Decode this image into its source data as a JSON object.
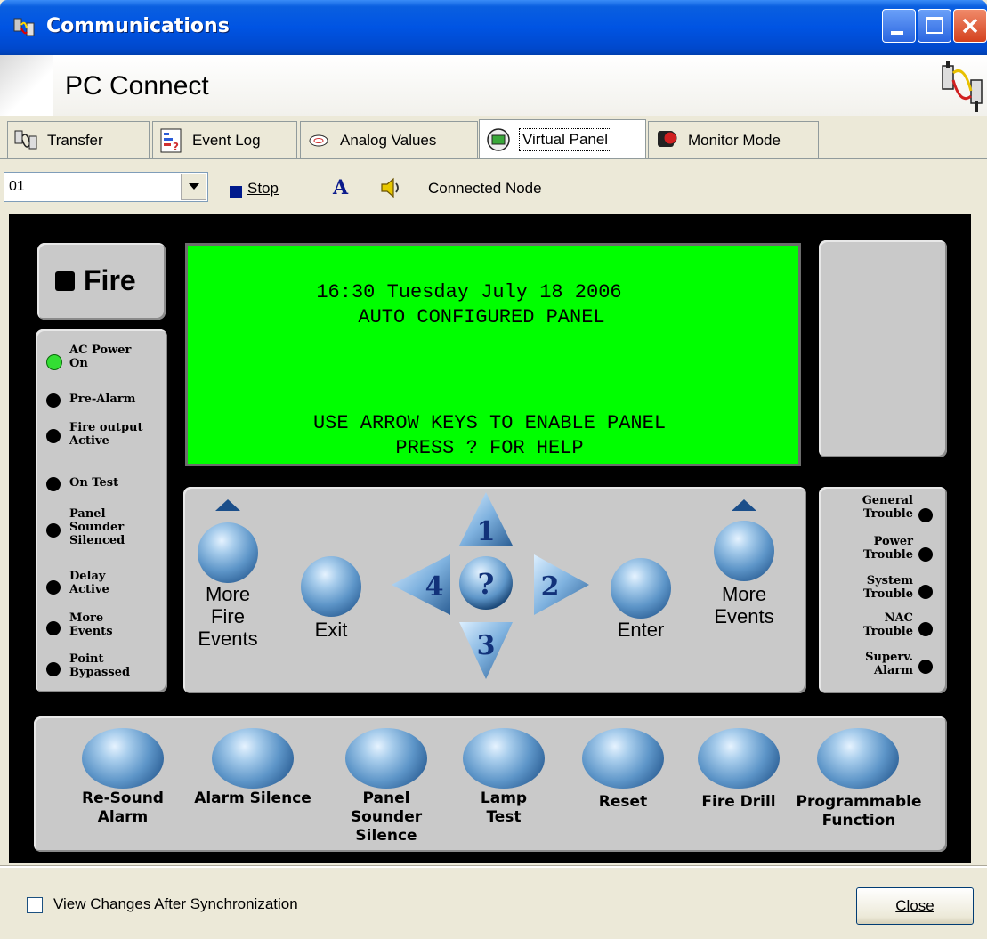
{
  "window": {
    "title": "Communications",
    "header_title": "PC Connect"
  },
  "tabs": [
    {
      "label": "Transfer",
      "icon": "transfer-icon"
    },
    {
      "label": "Event Log",
      "icon": "event-log-icon"
    },
    {
      "label": "Analog Values",
      "icon": "smoke-detector-icon"
    },
    {
      "label": "Virtual Panel",
      "icon": "virtual-panel-icon",
      "active": true
    },
    {
      "label": "Monitor Mode",
      "icon": "monitor-mode-icon"
    }
  ],
  "toolbar": {
    "node_value": "01",
    "stop_label": "Stop",
    "font_label": "A",
    "connected_label": "Connected Node"
  },
  "panel": {
    "fire_label": "Fire",
    "lcd": {
      "line1": "16:30 Tuesday July 18 2006",
      "line2": "AUTO CONFIGURED PANEL",
      "line3": "USE ARROW KEYS TO ENABLE PANEL",
      "line4": "PRESS ? FOR HELP"
    },
    "leds": [
      {
        "line1": "AC Power",
        "line2": "On",
        "color": "#33DD33"
      },
      {
        "line1": "Pre-Alarm",
        "line2": "",
        "color": "#000000"
      },
      {
        "line1": "Fire output",
        "line2": "Active",
        "color": "#000000"
      },
      {
        "line1": "On Test",
        "line2": "",
        "color": "#000000"
      },
      {
        "line1": "Panel",
        "line2": "Sounder",
        "line3": "Silenced",
        "color": "#000000"
      },
      {
        "line1": "Delay",
        "line2": "Active",
        "color": "#000000"
      },
      {
        "line1": "More",
        "line2": "Events",
        "color": "#000000"
      },
      {
        "line1": "Point",
        "line2": "Bypassed",
        "color": "#000000"
      }
    ],
    "nav": {
      "more_fire_events": [
        "More",
        "Fire",
        "Events"
      ],
      "exit": "Exit",
      "enter": "Enter",
      "more_events": [
        "More",
        "Events"
      ],
      "up": "1",
      "right": "2",
      "down": "3",
      "left": "4",
      "help": "?"
    },
    "troubles": [
      {
        "line1": "General",
        "line2": "Trouble"
      },
      {
        "line1": "Power",
        "line2": "Trouble"
      },
      {
        "line1": "System",
        "line2": "Trouble"
      },
      {
        "line1": "NAC",
        "line2": "Trouble"
      },
      {
        "line1": "Superv.",
        "line2": "Alarm"
      }
    ],
    "buttons": [
      {
        "lines": [
          "Re-Sound",
          "Alarm"
        ]
      },
      {
        "lines": [
          "Alarm Silence"
        ]
      },
      {
        "lines": [
          "Panel",
          "Sounder",
          "Silence"
        ]
      },
      {
        "lines": [
          "Lamp",
          "Test"
        ]
      },
      {
        "lines": [
          "Reset"
        ]
      },
      {
        "lines": [
          "Fire Drill"
        ]
      },
      {
        "lines": [
          "Programmable",
          "Function"
        ]
      }
    ]
  },
  "footer": {
    "checkbox_label": "View Changes After Synchronization",
    "close_label": "Close"
  },
  "colors": {
    "lcd": "#00FF00",
    "titlebar": "#0054E3",
    "panel_gray": "#C9C9C9",
    "ac_power_led": "#33DD33"
  }
}
